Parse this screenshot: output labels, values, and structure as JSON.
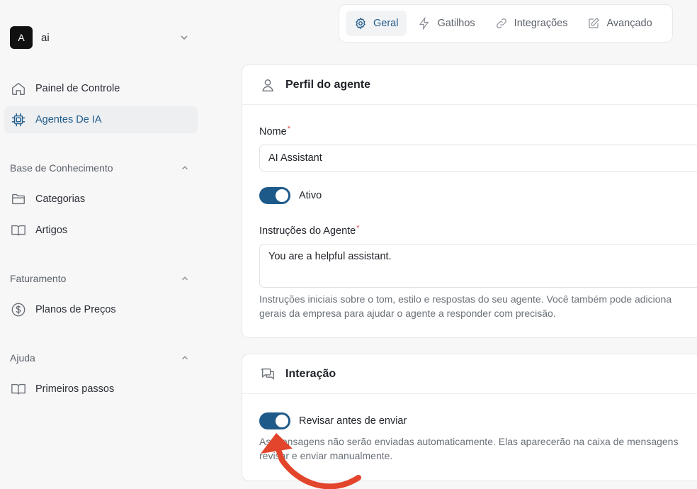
{
  "sidebar": {
    "workspace": {
      "badge": "A",
      "name": "ai"
    },
    "items": [
      {
        "label": "Painel de Controle",
        "icon": "home-icon"
      },
      {
        "label": "Agentes De IA",
        "icon": "cpu-icon",
        "active": true
      }
    ],
    "sections": [
      {
        "title": "Base de Conhecimento",
        "items": [
          {
            "label": "Categorias",
            "icon": "folder-icon"
          },
          {
            "label": "Artigos",
            "icon": "book-icon"
          }
        ]
      },
      {
        "title": "Faturamento",
        "items": [
          {
            "label": "Planos de Preços",
            "icon": "dollar-icon"
          }
        ]
      },
      {
        "title": "Ajuda",
        "items": [
          {
            "label": "Primeiros passos",
            "icon": "book-icon"
          }
        ]
      }
    ]
  },
  "tabs": [
    {
      "label": "Geral",
      "icon": "gear-icon",
      "active": true
    },
    {
      "label": "Gatilhos",
      "icon": "lightning-icon"
    },
    {
      "label": "Integrações",
      "icon": "link-icon"
    },
    {
      "label": "Avançado",
      "icon": "edit-icon"
    }
  ],
  "profile": {
    "title": "Perfil do agente",
    "name_label": "Nome",
    "name_value": "AI Assistant",
    "active_label": "Ativo",
    "active": true,
    "instructions_label": "Instruções do Agente",
    "instructions_value": "You are a helpful assistant.",
    "help_line1": "Instruções iniciais sobre o tom, estilo e respostas do seu agente. Você também pode adiciona",
    "help_line2": "gerais da empresa para ajudar o agente a responder com precisão."
  },
  "interaction": {
    "title": "Interação",
    "review_label": "Revisar antes de enviar",
    "review_enabled": true,
    "help_line1": "As mensagens não serão enviadas automaticamente. Elas aparecerão na caixa de mensagens",
    "help_line2": "revisar e enviar manualmente."
  },
  "colors": {
    "accent": "#1d5a8a",
    "annotation_arrow": "#e2452b",
    "required": "#e04848"
  }
}
